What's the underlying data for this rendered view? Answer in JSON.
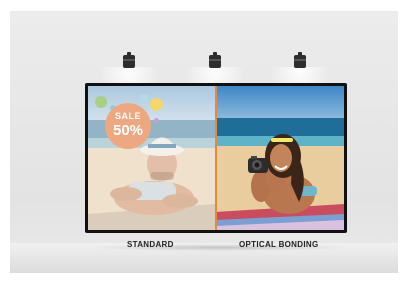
{
  "labels": {
    "left": "STANDARD",
    "right": "OPTICAL BONDING"
  },
  "promo": {
    "sale": "SALE",
    "discount": "50%"
  },
  "lamps": [
    "spotlight-left",
    "spotlight-center",
    "spotlight-right"
  ],
  "colors": {
    "divider": "#e7883f",
    "badge": "#eda882"
  }
}
